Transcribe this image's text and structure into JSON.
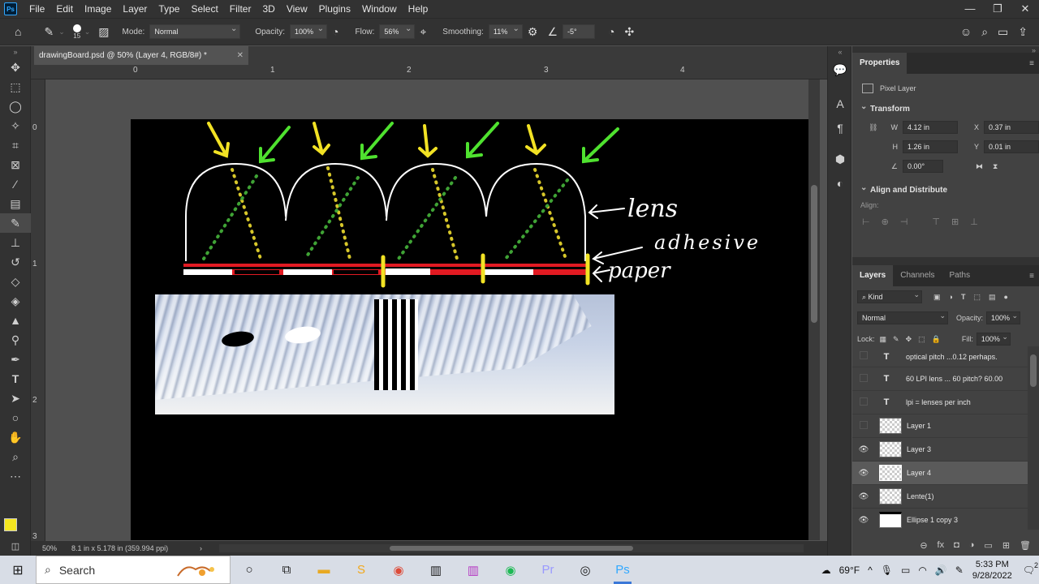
{
  "menubar": {
    "logo": "Ps",
    "items": [
      "File",
      "Edit",
      "Image",
      "Layer",
      "Type",
      "Select",
      "Filter",
      "3D",
      "View",
      "Plugins",
      "Window",
      "Help"
    ],
    "controls": {
      "minimize": "—",
      "restore": "❐",
      "close": "✕"
    }
  },
  "options": {
    "brush_size": "15",
    "mode_label": "Mode:",
    "mode_value": "Normal",
    "opacity_label": "Opacity:",
    "opacity_value": "100%",
    "flow_label": "Flow:",
    "flow_value": "56%",
    "smoothing_label": "Smoothing:",
    "smoothing_value": "11%",
    "angle_value": "-5°"
  },
  "document": {
    "tab_title": "drawingBoard.psd @ 50% (Layer 4, RGB/8#) *",
    "close": "✕",
    "ruler_top": [
      "0",
      "1",
      "2",
      "3",
      "4"
    ],
    "ruler_left": [
      "0",
      "1",
      "2",
      "3"
    ],
    "labels": {
      "lens": "lens",
      "adhesive": "adhesive",
      "paper": "paper"
    }
  },
  "status": {
    "zoom": "50%",
    "info": "8.1 in x 5.178 in (359.994 ppi)",
    "arrow": "›"
  },
  "properties": {
    "tab": "Properties",
    "layer_type": "Pixel Layer",
    "transform_title": "Transform",
    "w_label": "W",
    "w_value": "4.12 in",
    "x_label": "X",
    "x_value": "0.37 in",
    "h_label": "H",
    "h_value": "1.26 in",
    "y_label": "Y",
    "y_value": "0.01 in",
    "angle_value": "0.00°",
    "align_title": "Align and Distribute",
    "align_label": "Align:"
  },
  "layers": {
    "tabs": [
      "Layers",
      "Channels",
      "Paths"
    ],
    "kind_value": "Kind",
    "blend_value": "Normal",
    "opacity_label": "Opacity:",
    "opacity_value": "100%",
    "lock_label": "Lock:",
    "fill_label": "Fill:",
    "fill_value": "100%",
    "items": [
      {
        "name": "optical pitch ...0.12 perhaps.",
        "kind": "text",
        "visible": false,
        "selected": false
      },
      {
        "name": "60 LPI lens ... 60 pitch? 60.00",
        "kind": "text",
        "visible": false,
        "selected": false
      },
      {
        "name": "lpi = lenses per inch",
        "kind": "text",
        "visible": false,
        "selected": false
      },
      {
        "name": "Layer 1",
        "kind": "pixel",
        "visible": false,
        "selected": false
      },
      {
        "name": "Layer 3",
        "kind": "pixel",
        "visible": true,
        "selected": false
      },
      {
        "name": "Layer 4",
        "kind": "pixel",
        "visible": true,
        "selected": true
      },
      {
        "name": "Lente(1)",
        "kind": "pixel",
        "visible": true,
        "selected": false
      },
      {
        "name": "Ellipse 1 copy 3",
        "kind": "pixel",
        "visible": true,
        "selected": false
      }
    ],
    "text_thumb": "T",
    "footer": [
      "⊖",
      "fx",
      "◘",
      "◑",
      "▭",
      "⊞",
      "🗑"
    ]
  },
  "taskbar": {
    "search_placeholder": "Search",
    "weather": "69°F",
    "time": "5:33 PM",
    "date": "9/28/2022",
    "notification_count": "2"
  },
  "colors": {
    "foreground": "#f5e61f",
    "background": "#ffffff",
    "arrow_yellow": "#f2e224",
    "arrow_green": "#4fe22f",
    "stripe_red": "#e21a22"
  }
}
